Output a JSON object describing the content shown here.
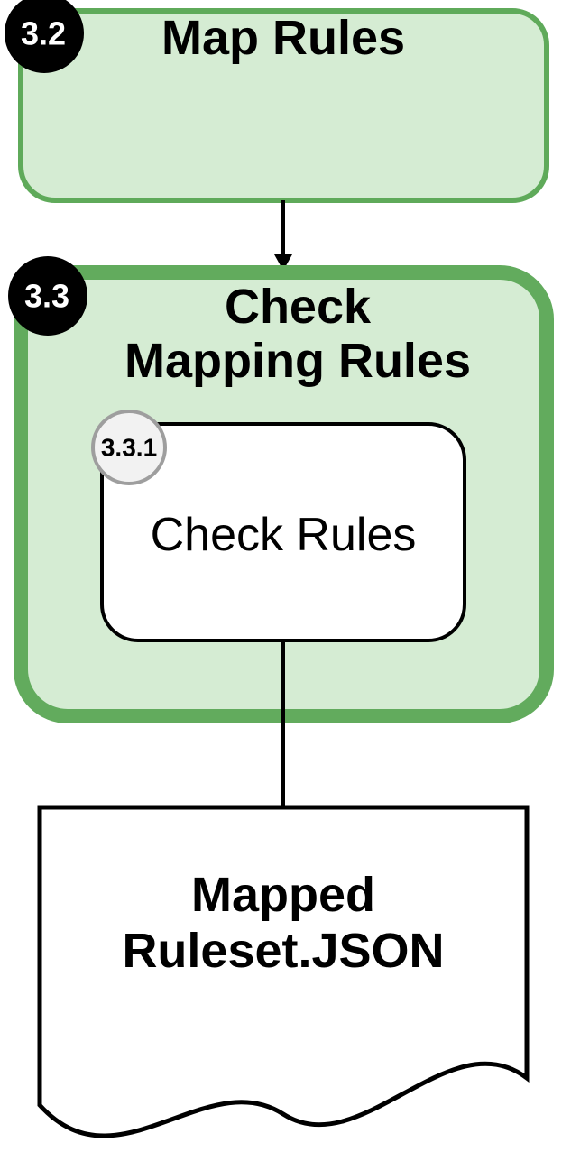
{
  "colors": {
    "node_fill": "#d5ecd3",
    "node_stroke_light": "#5faa5a",
    "node_stroke_bold": "#62ab5d",
    "badge_fill": "#000000",
    "badge_text": "#ffffff",
    "subbadge_fill": "#f2f2f2",
    "subbadge_stroke": "#9e9e9e",
    "line": "#000000",
    "doc_fill": "#ffffff"
  },
  "nodes": {
    "map_rules": {
      "badge": "3.2",
      "title": "Map Rules"
    },
    "check_mapping_rules": {
      "badge": "3.3",
      "title_line1": "Check",
      "title_line2": "Mapping Rules",
      "sub": {
        "badge": "3.3.1",
        "title": "Check Rules"
      }
    },
    "output_doc": {
      "title_line1": "Mapped",
      "title_line2": "Ruleset.JSON"
    }
  }
}
